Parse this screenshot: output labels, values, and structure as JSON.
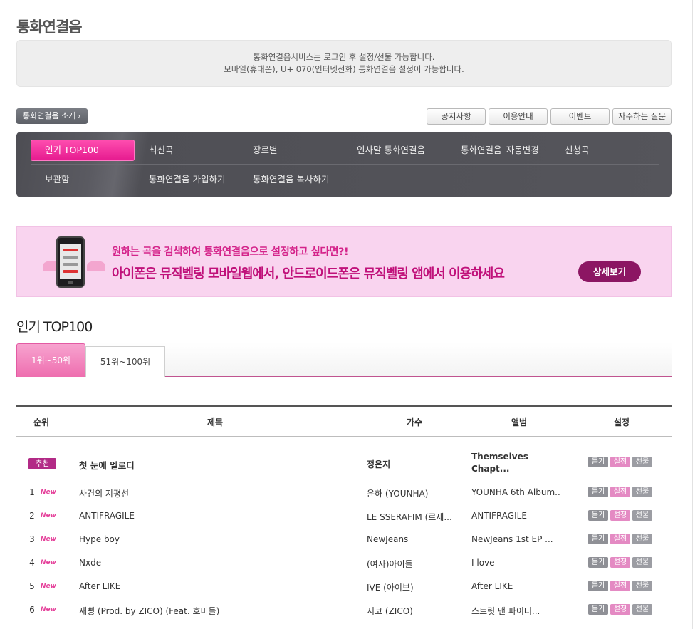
{
  "page_title": "통화연결음",
  "notice": {
    "line1": "통화연결음서비스는 로그인 후 설정/선물 가능합니다.",
    "line2": "모바일(휴대폰), U+ 070(인터넷전화) 통화연결음 설정이 가능합니다."
  },
  "intro_button": "통화연결음 소개",
  "top_links": [
    "공지사항",
    "이용안내",
    "이벤트",
    "자주하는 질문"
  ],
  "nav": {
    "items": [
      "인기 TOP100",
      "최신곡",
      "장르별",
      "인사말 통화연결음",
      "통화연결음_자동변경",
      "신청곡",
      "보관함",
      "통화연결음 가입하기",
      "통화연결음 복사하기"
    ]
  },
  "banner": {
    "line1": "원하는 곡을 검색하여 통화연결음으로 설정하고 싶다면?!",
    "line2": "아이폰은 뮤직벨링 모바일웹에서, 안드로이드폰은 뮤직벨링 앱에서 이용하세요",
    "button": "상세보기"
  },
  "section_title": "인기 TOP100",
  "tabs": [
    "1위~50위",
    "51위~100위"
  ],
  "table": {
    "headers": {
      "rank": "순위",
      "title": "제목",
      "artist": "가수",
      "album": "앨범",
      "setting": "설정"
    },
    "actions": {
      "listen": "듣기",
      "set": "설정",
      "gift": "선물"
    },
    "recommended": {
      "badge": "추천",
      "title": "첫 눈에 멜로디",
      "artist": "정은지",
      "album": "Themselves Chapt..."
    },
    "rows": [
      {
        "rank": "1",
        "new": "New",
        "title": "사건의 지평선",
        "artist": "윤하 (YOUNHA)",
        "album": "YOUNHA 6th Album..."
      },
      {
        "rank": "2",
        "new": "New",
        "title": "ANTIFRAGILE",
        "artist": "LE SSERAFIM (르세...",
        "album": "ANTIFRAGILE"
      },
      {
        "rank": "3",
        "new": "New",
        "title": "Hype boy",
        "artist": "NewJeans",
        "album": "NewJeans 1st EP ..."
      },
      {
        "rank": "4",
        "new": "New",
        "title": "Nxde",
        "artist": "(여자)아이들",
        "album": "I love"
      },
      {
        "rank": "5",
        "new": "New",
        "title": "After LIKE",
        "artist": "IVE (아이브)",
        "album": "After LIKE"
      },
      {
        "rank": "6",
        "new": "New",
        "title": "새삥 (Prod. by ZICO) (Feat. 호미들)",
        "artist": "지코 (ZICO)",
        "album": "스트릿 맨 파이터..."
      }
    ]
  },
  "colors": {
    "accent": "#e5198e",
    "banner_bg": "#f9d4ef",
    "nav_bg": "#55555b"
  }
}
